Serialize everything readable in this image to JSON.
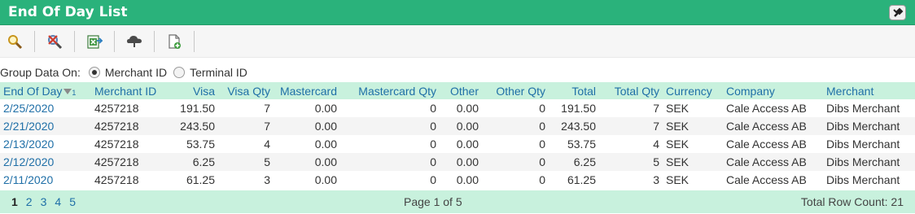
{
  "window": {
    "title": "End Of Day List"
  },
  "toolbar": {
    "buttons": [
      "search-icon",
      "clear-search-icon",
      "export-excel-icon",
      "cloud-upload-icon",
      "new-document-icon"
    ]
  },
  "group": {
    "label": "Group Data On:",
    "options": [
      {
        "label": "Merchant ID",
        "checked": true
      },
      {
        "label": "Terminal ID",
        "checked": false
      }
    ]
  },
  "table": {
    "columns": [
      "End Of Day",
      "Merchant ID",
      "Visa",
      "Visa Qty",
      "Mastercard",
      "Mastercard Qty",
      "Other",
      "Other Qty",
      "Total",
      "Total Qty",
      "Currency",
      "Company",
      "Merchant"
    ],
    "sort_index": "1",
    "rows": [
      [
        "2/25/2020",
        "4257218",
        "191.50",
        "7",
        "0.00",
        "0",
        "0.00",
        "0",
        "191.50",
        "7",
        "SEK",
        "Cale Access AB",
        "Dibs Merchant"
      ],
      [
        "2/21/2020",
        "4257218",
        "243.50",
        "7",
        "0.00",
        "0",
        "0.00",
        "0",
        "243.50",
        "7",
        "SEK",
        "Cale Access AB",
        "Dibs Merchant"
      ],
      [
        "2/13/2020",
        "4257218",
        "53.75",
        "4",
        "0.00",
        "0",
        "0.00",
        "0",
        "53.75",
        "4",
        "SEK",
        "Cale Access AB",
        "Dibs Merchant"
      ],
      [
        "2/12/2020",
        "4257218",
        "6.25",
        "5",
        "0.00",
        "0",
        "0.00",
        "0",
        "6.25",
        "5",
        "SEK",
        "Cale Access AB",
        "Dibs Merchant"
      ],
      [
        "2/11/2020",
        "4257218",
        "61.25",
        "3",
        "0.00",
        "0",
        "0.00",
        "0",
        "61.25",
        "3",
        "SEK",
        "Cale Access AB",
        "Dibs Merchant"
      ]
    ]
  },
  "pager": {
    "pages": [
      "1",
      "2",
      "3",
      "4",
      "5"
    ],
    "current": "1",
    "info": "Page 1 of 5",
    "row_count": "Total Row Count: 21"
  },
  "colors": {
    "header_green": "#2ab27b",
    "table_header_bg": "#c8f1dd",
    "link_blue": "#1f6fa7"
  }
}
